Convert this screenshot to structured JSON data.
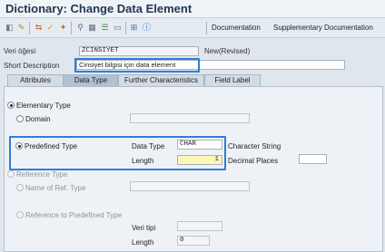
{
  "window": {
    "title": "Dictionary: Change Data Element"
  },
  "toolbar": {
    "icons": [
      "other-object-icon",
      "display-change-icon",
      "active-inactive-icon",
      "check-icon",
      "activate-icon",
      "where-used-icon",
      "object-list-icon",
      "display-object-list-icon",
      "navigation-window-icon",
      "hierarchy-icon",
      "info-icon"
    ],
    "documentation_label": "Documentation",
    "supplementary_label": "Supplementary Documentation"
  },
  "header": {
    "element_label": "Veri öğesi",
    "element_value": "ZCINSIYET",
    "status": "New(Revised)",
    "short_desc_label": "Short Description",
    "short_desc_value": "Cinsiyet bilgisi için data element"
  },
  "tabs": [
    {
      "label": "Attributes",
      "active": false
    },
    {
      "label": "Data Type",
      "active": true
    },
    {
      "label": "Further Characteristics",
      "active": false
    },
    {
      "label": "Field Label",
      "active": false
    }
  ],
  "data_type": {
    "elementary_label": "Elementary Type",
    "domain_label": "Domain",
    "domain_value": "",
    "predefined_label": "Predefined Type",
    "data_type_label": "Data Type",
    "data_type_value": "CHAR",
    "data_type_desc": "Character String",
    "length_label": "Length",
    "length_value": "1",
    "decimal_label": "Decimal Places",
    "decimal_value": "",
    "reference_label": "Reference Type",
    "ref_name_label": "Name of Ref. Type",
    "ref_name_value": "",
    "ref_predefined_label": "Reference to Predefined Type",
    "veri_tipi_label": "Veri tipi",
    "veri_tipi_value": "",
    "ref_length_label": "Length",
    "ref_length_value": "0"
  },
  "colors": {
    "highlight": "#2f7ed8",
    "title": "#22384e",
    "length_input_bg": "#fff5b8"
  }
}
